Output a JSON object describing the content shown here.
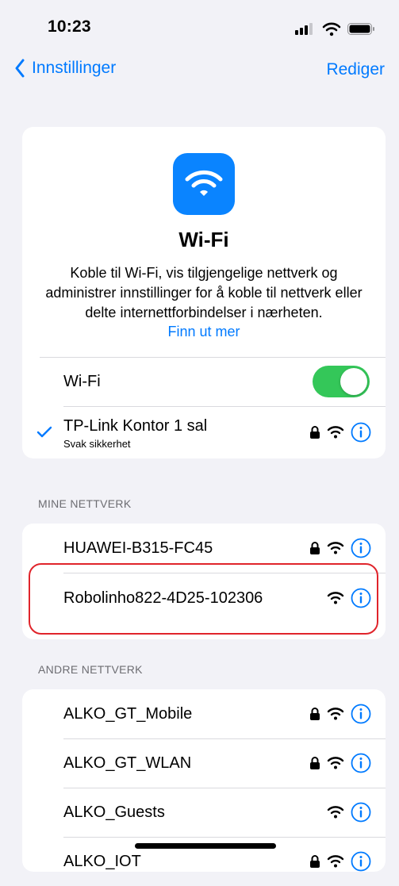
{
  "status_bar": {
    "time": "10:23"
  },
  "nav": {
    "back_label": "Innstillinger",
    "edit_label": "Rediger"
  },
  "hero": {
    "title": "Wi-Fi",
    "description": "Koble til Wi-Fi, vis tilgjengelige nettverk og administrer innstillinger for å koble til nettverk eller delte internettforbindelser i nærheten.",
    "link": "Finn ut mer"
  },
  "wifi_toggle": {
    "label": "Wi-Fi",
    "on": true
  },
  "connected": {
    "name": "TP-Link Kontor 1 sal",
    "subtitle": "Svak sikkerhet",
    "locked": true,
    "selected": true
  },
  "my_networks": {
    "header": "MINE NETTVERK",
    "items": [
      {
        "name": "HUAWEI-B315-FC45",
        "locked": true
      },
      {
        "name": "Robolinho822-4D25-102306",
        "locked": false
      }
    ]
  },
  "other_networks": {
    "header": "ANDRE NETTVERK",
    "items": [
      {
        "name": "ALKO_GT_Mobile",
        "locked": true
      },
      {
        "name": "ALKO_GT_WLAN",
        "locked": true
      },
      {
        "name": "ALKO_Guests",
        "locked": false
      },
      {
        "name": "ALKO_IOT",
        "locked": true
      }
    ]
  },
  "colors": {
    "accent": "#007aff",
    "toggle_on": "#34c759",
    "highlight": "#e0242b",
    "wifi_app": "#0a84ff"
  },
  "icons": [
    "chevron-left-icon",
    "wifi-icon",
    "lock-icon",
    "info-icon",
    "checkmark-icon",
    "signal-icon",
    "battery-icon"
  ]
}
